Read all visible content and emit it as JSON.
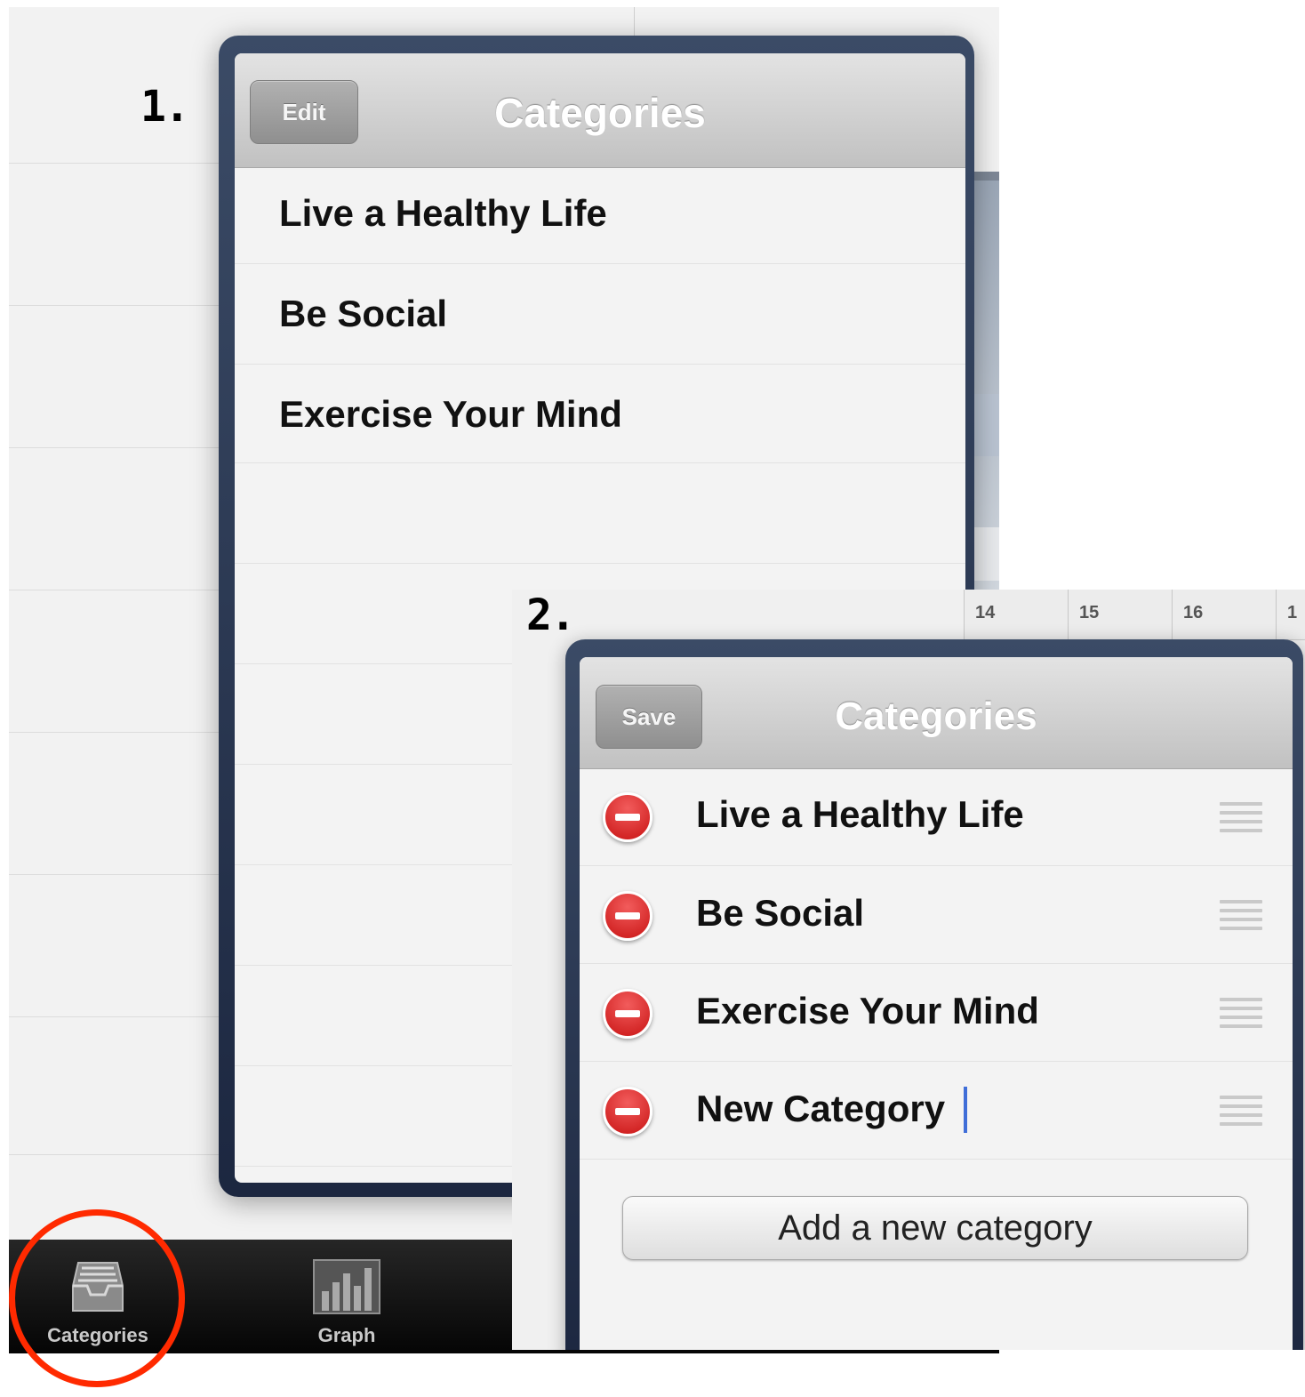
{
  "step_markers": {
    "first": "1.",
    "second": "2."
  },
  "screen1": {
    "navbar": {
      "edit_label": "Edit",
      "title": "Categories"
    },
    "categories": [
      "Live a Healthy Life",
      "Be Social",
      "Exercise Your Mind"
    ],
    "tabbar": {
      "tabs": [
        {
          "label": "Categories",
          "icon": "inbox-tray-icon",
          "highlighted": true
        },
        {
          "label": "Graph",
          "icon": "bar-graph-icon",
          "highlighted": false
        }
      ]
    }
  },
  "screen2": {
    "calendar_days": [
      "14",
      "15",
      "16",
      "1"
    ],
    "navbar": {
      "save_label": "Save",
      "title": "Categories"
    },
    "categories": [
      {
        "label": "Live a Healthy Life"
      },
      {
        "label": "Be Social"
      },
      {
        "label": "Exercise Your Mind"
      },
      {
        "label": "New Category",
        "editing": true
      }
    ],
    "add_button_label": "Add a new category"
  },
  "colors": {
    "highlight_circle": "#ff2a00",
    "popover_frame": "#1c2740",
    "delete_red": "#c91414",
    "text_caret": "#3f6ed8",
    "tabbar_bg": "#050505"
  }
}
